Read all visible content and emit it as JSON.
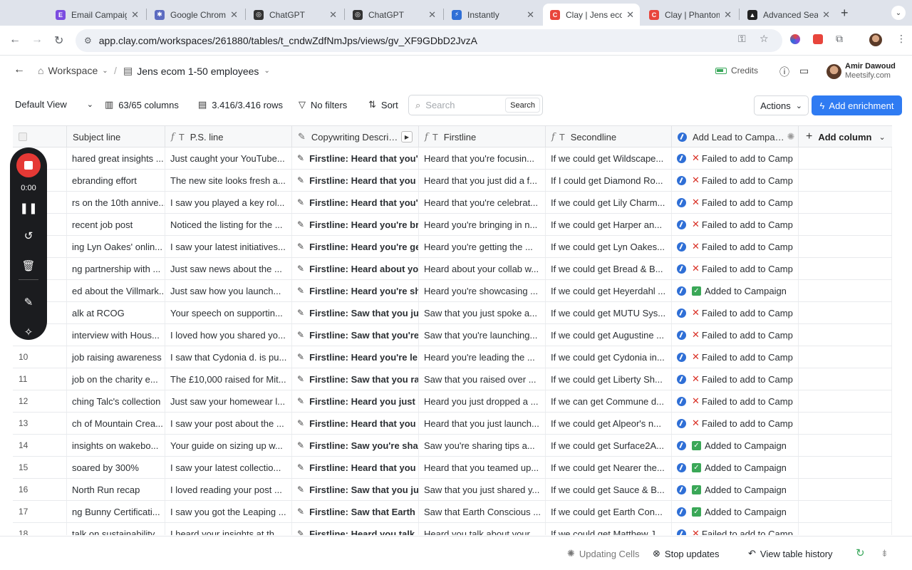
{
  "browser": {
    "tabs": [
      {
        "title": "Email Campaig",
        "color": "#7b4ce0",
        "glyph": "E"
      },
      {
        "title": "Google Chrom",
        "color": "#5c6bc0",
        "glyph": "✱"
      },
      {
        "title": "ChatGPT",
        "color": "#333333",
        "glyph": "◎"
      },
      {
        "title": "ChatGPT",
        "color": "#333333",
        "glyph": "◎"
      },
      {
        "title": "Instantly",
        "color": "#2f6fd6",
        "glyph": "⚡"
      },
      {
        "title": "Clay | Jens eco",
        "color": "#e8453c",
        "glyph": "C"
      },
      {
        "title": "Clay | Phantom",
        "color": "#e8453c",
        "glyph": "C"
      },
      {
        "title": "Advanced Sea",
        "color": "#222222",
        "glyph": "▲"
      }
    ],
    "url": "app.clay.com/workspaces/261880/tables/t_cndwZdfNmJps/views/gv_XF9GDbD2JvzA"
  },
  "header": {
    "workspace": "Workspace",
    "table_name": "Jens ecom 1-50 employees",
    "credits": "Credits",
    "user_name": "Amir Dawoud",
    "user_org": "Meetsify.com"
  },
  "toolbar": {
    "view": "Default View",
    "columns": "63/65 columns",
    "rows": "3.416/3.416 rows",
    "filters": "No filters",
    "sort": "Sort",
    "search_placeholder": "Search",
    "search_button": "Search",
    "actions": "Actions",
    "add_enrichment": "Add enrichment"
  },
  "recorder": {
    "time": "0:00"
  },
  "table": {
    "headers": [
      "Subject line",
      "P.S. line",
      "Copywriting Descri…",
      "Firstline",
      "Secondline",
      "Add Lead to Campa…",
      "Add column"
    ],
    "rows": [
      {
        "n": "",
        "subject": "hared great insights ...",
        "ps": "Just caught your YouTube...",
        "copy": "Firstline: Heard that you'",
        "first": "Heard that you're focusin...",
        "second": "If we could get Wildscape...",
        "status": "fail"
      },
      {
        "n": "",
        "subject": "ebranding effort",
        "ps": "The new site looks fresh a...",
        "copy": "Firstline: Heard that you",
        "first": "Heard that you just did a f...",
        "second": "If I could get Diamond Ro...",
        "status": "fail"
      },
      {
        "n": "",
        "subject": "rs on the 10th annive...",
        "ps": "I saw you played a key rol...",
        "copy": "Firstline: Heard that you'",
        "first": "Heard that you're celebrat...",
        "second": "If we could get Lily Charm...",
        "status": "fail"
      },
      {
        "n": "",
        "subject": "recent job post",
        "ps": "Noticed the listing for the ...",
        "copy": "Firstline: Heard you're br",
        "first": "Heard you're bringing in n...",
        "second": "If we could get Harper an...",
        "status": "fail"
      },
      {
        "n": "",
        "subject": "ing Lyn Oakes' onlin...",
        "ps": "I saw your latest initiatives...",
        "copy": "Firstline: Heard you're ge",
        "first": "Heard you're getting the ...",
        "second": "If we could get Lyn Oakes...",
        "status": "fail"
      },
      {
        "n": "",
        "subject": "ng partnership with ...",
        "ps": "Just saw news about the ...",
        "copy": "Firstline: Heard about yo",
        "first": "Heard about your collab w...",
        "second": "If we could get Bread & B...",
        "status": "fail"
      },
      {
        "n": "",
        "subject": "ed about the Villmark...",
        "ps": "Just saw how you launch...",
        "copy": "Firstline: Heard you're sh",
        "first": "Heard you're showcasing ...",
        "second": "If we could get Heyerdahl ...",
        "status": "ok"
      },
      {
        "n": "",
        "subject": "alk at RCOG",
        "ps": "Your speech on supportin...",
        "copy": "Firstline: Saw that you ju",
        "first": "Saw that you just spoke a...",
        "second": "If we could get MUTU Sys...",
        "status": "fail"
      },
      {
        "n": "",
        "subject": "interview with Hous...",
        "ps": "I loved how you shared yo...",
        "copy": "Firstline: Saw that you're",
        "first": "Saw that you're launching...",
        "second": "If we could get Augustine ...",
        "status": "fail"
      },
      {
        "n": "10",
        "subject": "job raising awareness",
        "ps": "I saw that Cydonia d. is pu...",
        "copy": "Firstline: Heard you're le",
        "first": "Heard you're leading the ...",
        "second": "If we could get Cydonia in...",
        "status": "fail"
      },
      {
        "n": "11",
        "subject": "job on the charity e...",
        "ps": "The £10,000 raised for Mit...",
        "copy": "Firstline: Saw that you ra",
        "first": "Saw that you raised over ...",
        "second": "If we could get Liberty Sh...",
        "status": "fail"
      },
      {
        "n": "12",
        "subject": "ching Talc's collection",
        "ps": "Just saw your homewear l...",
        "copy": "Firstline: Heard you just",
        "first": "Heard you just dropped a ...",
        "second": "If we can get Commune d...",
        "status": "fail"
      },
      {
        "n": "13",
        "subject": "ch of Mountain Crea...",
        "ps": "I saw your post about the ...",
        "copy": "Firstline: Heard that you",
        "first": "Heard that you just launch...",
        "second": "If we could get Alpeor's n...",
        "status": "fail"
      },
      {
        "n": "14",
        "subject": "insights on wakebo...",
        "ps": "Your guide on sizing up w...",
        "copy": "Firstline: Saw you're sha",
        "first": "Saw you're sharing tips a...",
        "second": "If we could get Surface2A...",
        "status": "ok"
      },
      {
        "n": "15",
        "subject": "soared by 300%",
        "ps": "I saw your latest collectio...",
        "copy": "Firstline: Heard that you",
        "first": "Heard that you teamed up...",
        "second": "If we could get Nearer the...",
        "status": "ok"
      },
      {
        "n": "16",
        "subject": "North Run recap",
        "ps": "I loved reading your post ...",
        "copy": "Firstline: Saw that you ju",
        "first": "Saw that you just shared y...",
        "second": "If we could get Sauce & B...",
        "status": "ok"
      },
      {
        "n": "17",
        "subject": "ng Bunny Certificati...",
        "ps": "I saw you got the Leaping ...",
        "copy": "Firstline: Saw that Earth",
        "first": "Saw that Earth Conscious ...",
        "second": "If we could get Earth Con...",
        "status": "ok"
      },
      {
        "n": "18",
        "subject": "talk on sustainability",
        "ps": "I heard your insights at th...",
        "copy": "Firstline: Heard you talk",
        "first": "Heard you talk about your...",
        "second": "If we could get Matthew J...",
        "status": "fail"
      }
    ],
    "status_labels": {
      "fail": "Failed to add to Camp",
      "ok": "Added to Campaign"
    }
  },
  "footer": {
    "updating": "Updating Cells",
    "stop": "Stop updates",
    "history": "View table history"
  }
}
